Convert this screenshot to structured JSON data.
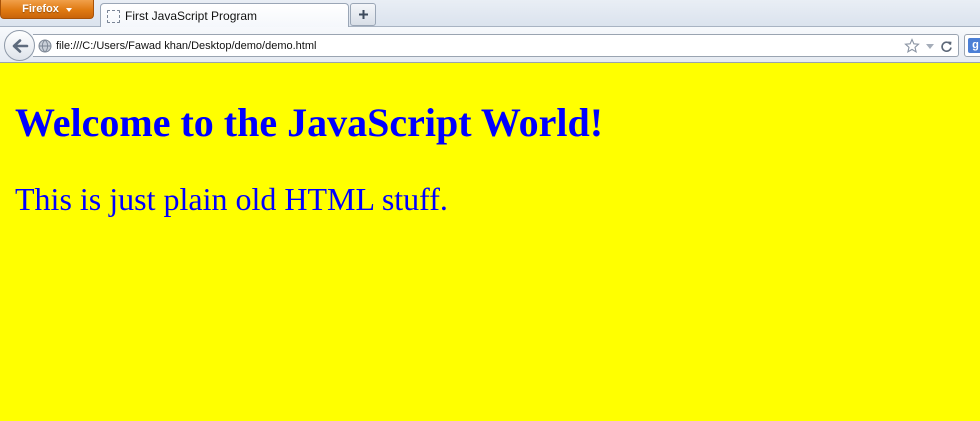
{
  "browser": {
    "app_button_label": "Firefox",
    "tab_title": "First JavaScript Program",
    "url": "file:///C:/Users/Fawad khan/Desktop/demo/demo.html"
  },
  "page": {
    "heading": "Welcome to the JavaScript World!",
    "paragraph": "This is just plain old HTML stuff."
  },
  "colors": {
    "page_background": "#ffff00",
    "text": "#0000ff",
    "app_button": "#e07a12"
  },
  "icons": [
    "chevron-down-icon",
    "page-icon",
    "plus-icon",
    "back-arrow-icon",
    "globe-icon",
    "star-icon",
    "dropdown-arrow-icon",
    "reload-icon",
    "google-icon"
  ]
}
